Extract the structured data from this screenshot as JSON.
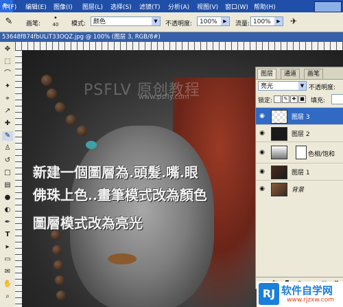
{
  "menu": {
    "app_mark": "Ps",
    "items": [
      "件(F)",
      "编辑(E)",
      "图像(I)",
      "图层(L)",
      "选择(S)",
      "滤镜(T)",
      "分析(A)",
      "视图(V)",
      "窗口(W)",
      "帮助(H)"
    ]
  },
  "options": {
    "brush_label": "画笔:",
    "brush_size": "40",
    "mode_label": "模式:",
    "mode_value": "颜色",
    "opacity_label": "不透明度:",
    "opacity_value": "100%",
    "flow_label": "流量:",
    "flow_value": "100%"
  },
  "document": {
    "title": "53648f874fbULiT33OQZ.jpg @ 100% (图层 3, RGB/8#)"
  },
  "watermark": {
    "main": "PSFLV 原创教程",
    "url": "www.psfly.com"
  },
  "captions": [
    "新建一個圖層為.頭髮.嘴.眼",
    "佛珠上色..畫筆模式改為顏色",
    "圖層模式改為亮光"
  ],
  "layers_panel": {
    "tabs": [
      "图层",
      "通道",
      "画笔"
    ],
    "blend_mode": "亮光",
    "opacity_label": "不透明度:",
    "lock_label": "锁定:",
    "fill_label": "填充:",
    "layers": [
      {
        "name": "图层 3",
        "selected": true
      },
      {
        "name": "图层 2",
        "selected": false
      },
      {
        "name": "色相/饱和",
        "selected": false
      },
      {
        "name": "图层 1",
        "selected": false
      },
      {
        "name": "背景",
        "selected": false
      }
    ],
    "footer_icons": [
      "link-icon",
      "fx-icon",
      "mask-icon",
      "adjustment-icon",
      "folder-icon",
      "new-layer-icon",
      "trash-icon"
    ]
  },
  "logo": {
    "mark": "RJ",
    "name": "软件自学网",
    "url": "www.rjzxw.com"
  },
  "colors": {
    "menubar": "#1f4fa8",
    "selected_layer": "#316ac5",
    "logo_blue": "#1a7fd8",
    "logo_orange": "#e0441a"
  }
}
